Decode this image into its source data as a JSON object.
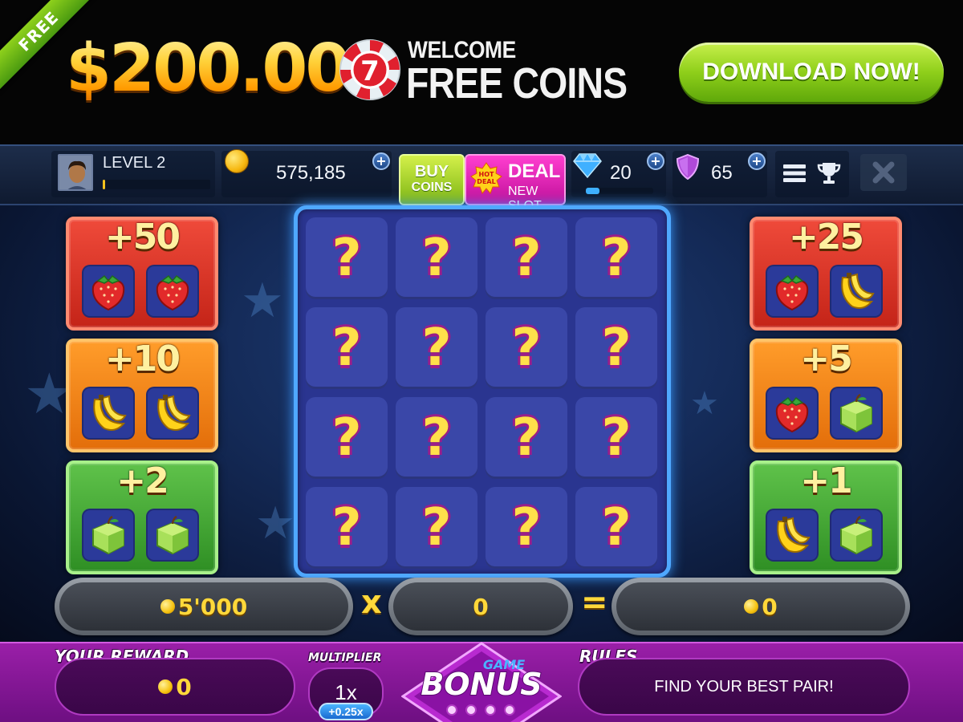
{
  "banner": {
    "ribbon": "FREE",
    "amount": "$200.000",
    "chip_number": "7",
    "welcome": "WELCOME",
    "free_coins": "FREE COINS",
    "download_label": "DOWNLOAD NOW!"
  },
  "status_bar": {
    "level_label": "LEVEL 2",
    "level_progress": 0.02,
    "coins": "575,185",
    "plus": "+",
    "buy_coins": {
      "line1": "BUY",
      "line2": "COINS"
    },
    "hot_deal_badge": {
      "line1": "HOT",
      "line2": "DEAL"
    },
    "deal": {
      "label": "DEAL",
      "sublabel": "NEW SLOT"
    },
    "gems": "20",
    "gem_progress": 0.2,
    "shields": "65"
  },
  "paytable_left": [
    {
      "value": "+50",
      "color": "red",
      "fruits": [
        "strawberry",
        "strawberry"
      ]
    },
    {
      "value": "+10",
      "color": "orange",
      "fruits": [
        "banana",
        "banana"
      ]
    },
    {
      "value": "+2",
      "color": "green",
      "fruits": [
        "apple",
        "apple"
      ]
    }
  ],
  "paytable_right": [
    {
      "value": "+25",
      "color": "red",
      "fruits": [
        "strawberry",
        "banana"
      ]
    },
    {
      "value": "+5",
      "color": "orange",
      "fruits": [
        "strawberry",
        "apple"
      ]
    },
    {
      "value": "+1",
      "color": "green",
      "fruits": [
        "banana",
        "apple"
      ]
    }
  ],
  "board": {
    "tile_symbol": "?",
    "rows": 4,
    "cols": 4
  },
  "equation": {
    "bet": "5'000",
    "times_sign": "x",
    "multiplier": "0",
    "equals_sign": "=",
    "result": "0"
  },
  "bottom": {
    "reward_title": "YOUR REWARD",
    "reward_value": "0",
    "multiplier_title": "MULTIPLIER",
    "multiplier_value": "1x",
    "multiplier_badge": "+0.25x",
    "bonus_small": "GAME",
    "bonus_big": "BONUS",
    "rules_title": "RULES",
    "rules_text": "FIND YOUR BEST PAIR!"
  },
  "colors": {
    "accent_green": "#8fcf1a",
    "accent_magenta": "#c0109a",
    "board_border": "#4fa8ff",
    "gold": "#ffd83a"
  }
}
